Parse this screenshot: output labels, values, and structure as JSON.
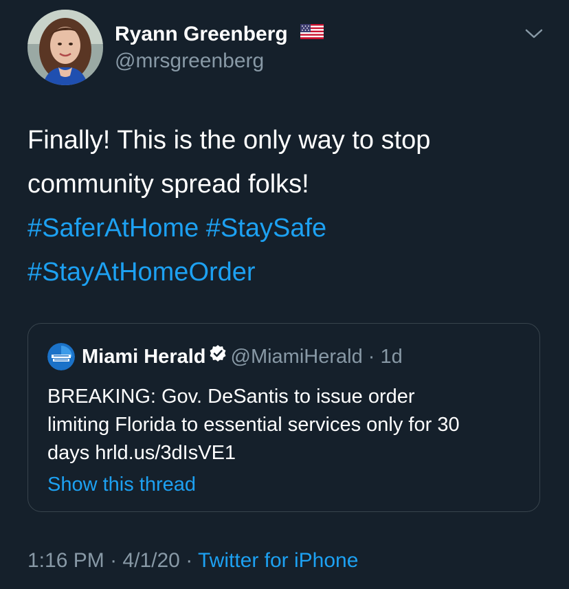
{
  "author": {
    "name": "Ryann Greenberg",
    "flag_icon": "us-flag-icon",
    "handle": "@mrsgreenberg"
  },
  "menu": {
    "icon": "chevron-down-icon"
  },
  "tweet": {
    "line1": "Finally!  This is the only way to stop",
    "line2": "community spread folks!",
    "hashtag1": "#SaferAtHome",
    "hashtag2": "#StaySafe",
    "hashtag3": "#StayAtHomeOrder"
  },
  "quote": {
    "name": "Miami Herald",
    "verified_icon": "verified-badge-icon",
    "handle": "@MiamiHerald",
    "separator": "·",
    "age": "1d",
    "text_line1": "BREAKING: Gov. DeSantis to issue order",
    "text_line2": "limiting Florida to essential services only for 30",
    "text_line3": "days hrld.us/3dIsVE1",
    "show_thread": "Show this thread"
  },
  "meta": {
    "time": "1:16 PM",
    "sep1": "·",
    "date": "4/1/20",
    "sep2": "·",
    "source": "Twitter for iPhone"
  },
  "colors": {
    "background": "#15202b",
    "accent": "#1da1f2",
    "secondary_text": "#8899a6",
    "border": "#38444d"
  }
}
